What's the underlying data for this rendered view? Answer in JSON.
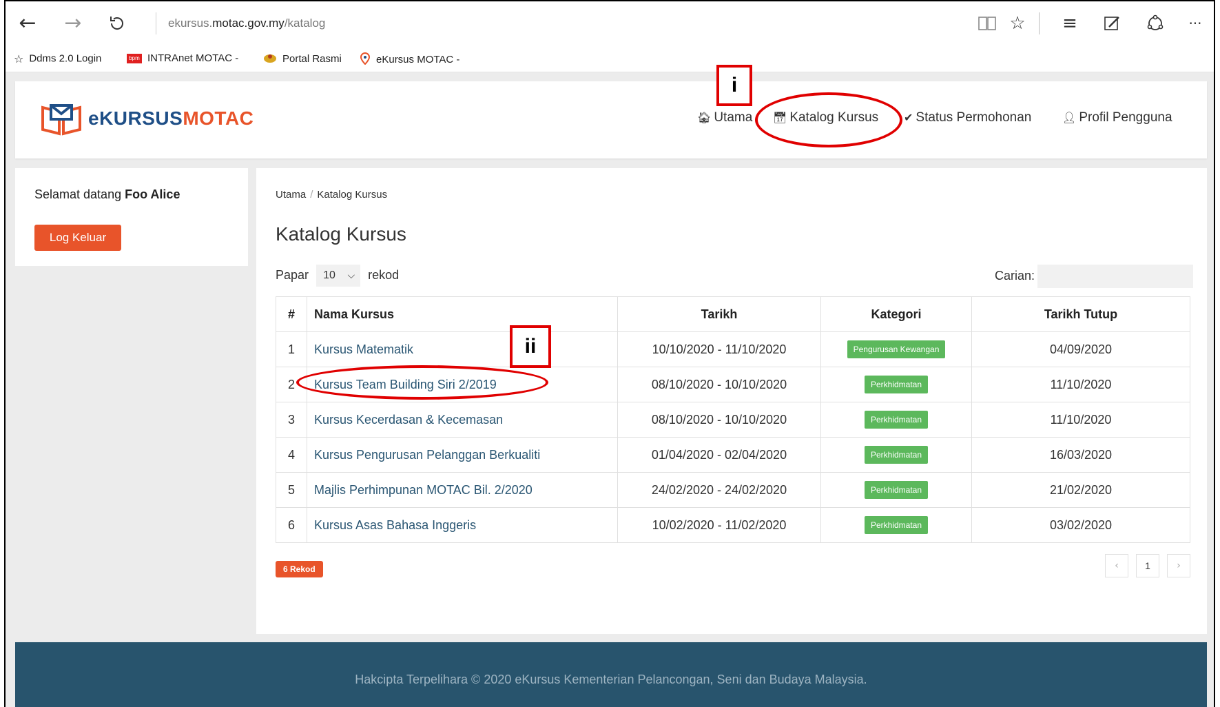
{
  "browser": {
    "url_prefix": "ekursus.",
    "url_domain": "motac.gov.my",
    "url_path": "/katalog",
    "icons": {
      "back": "arrow-left-icon",
      "forward": "arrow-right-icon",
      "refresh": "refresh-icon",
      "reading": "reading-view-icon",
      "favorite": "star-icon",
      "hub": "hub-icon",
      "note": "web-note-icon",
      "share": "share-icon",
      "more": "more-icon"
    }
  },
  "favorites": [
    {
      "label": "Ddms 2.0 Login",
      "icon": "star-outline-icon"
    },
    {
      "label": "INTRAnet MOTAC -",
      "icon": "bpm-logo-icon"
    },
    {
      "label": "Portal Rasmi",
      "icon": "crest-icon"
    },
    {
      "label": "eKursus MOTAC -",
      "icon": "map-pin-icon"
    }
  ],
  "header": {
    "logo_e": "eKURSUS",
    "logo_m": "MOTAC",
    "nav": [
      {
        "label": "Utama",
        "icon": "home-icon"
      },
      {
        "label": "Katalog Kursus",
        "icon": "calendar-icon"
      },
      {
        "label": "Status Permohonan",
        "icon": "check-circle-icon"
      },
      {
        "label": "Profil Pengguna",
        "icon": "user-icon"
      }
    ]
  },
  "sidebar": {
    "welcome_prefix": "Selamat datang",
    "user_name": "Foo Alice",
    "logout_label": "Log Keluar"
  },
  "main": {
    "breadcrumb": [
      "Utama",
      "Katalog Kursus"
    ],
    "title": "Katalog Kursus",
    "papar_label": "Papar",
    "page_size": "10",
    "rekod_label": "rekod",
    "search_label": "Carian:",
    "columns": [
      "#",
      "Nama Kursus",
      "Tarikh",
      "Kategori",
      "Tarikh Tutup"
    ],
    "rows": [
      {
        "no": "1",
        "name": "Kursus Matematik",
        "date": "10/10/2020 - 11/10/2020",
        "category": "Pengurusan Kewangan",
        "close": "04/09/2020"
      },
      {
        "no": "2",
        "name": "Kursus Team Building Siri 2/2019",
        "date": "08/10/2020 - 10/10/2020",
        "category": "Perkhidmatan",
        "close": "11/10/2020"
      },
      {
        "no": "3",
        "name": "Kursus Kecerdasan & Kecemasan",
        "date": "08/10/2020 - 10/10/2020",
        "category": "Perkhidmatan",
        "close": "11/10/2020"
      },
      {
        "no": "4",
        "name": "Kursus Pengurusan Pelanggan Berkualiti",
        "date": "01/04/2020 - 02/04/2020",
        "category": "Perkhidmatan",
        "close": "16/03/2020"
      },
      {
        "no": "5",
        "name": "Majlis Perhimpunan MOTAC Bil. 2/2020",
        "date": "24/02/2020 - 24/02/2020",
        "category": "Perkhidmatan",
        "close": "21/02/2020"
      },
      {
        "no": "6",
        "name": "Kursus Asas Bahasa Inggeris",
        "date": "10/02/2020 - 11/02/2020",
        "category": "Perkhidmatan",
        "close": "03/02/2020"
      }
    ],
    "record_badge": "6 Rekod",
    "pagination": {
      "prev": "‹",
      "current": "1",
      "next": "›"
    }
  },
  "footer": {
    "text": "Hakcipta Terpelihara © 2020 eKursus Kementerian Pelancongan, Seni dan Budaya Malaysia."
  },
  "annotations": {
    "label_i": "i",
    "label_ii": "ii",
    "color": "#e00000"
  }
}
